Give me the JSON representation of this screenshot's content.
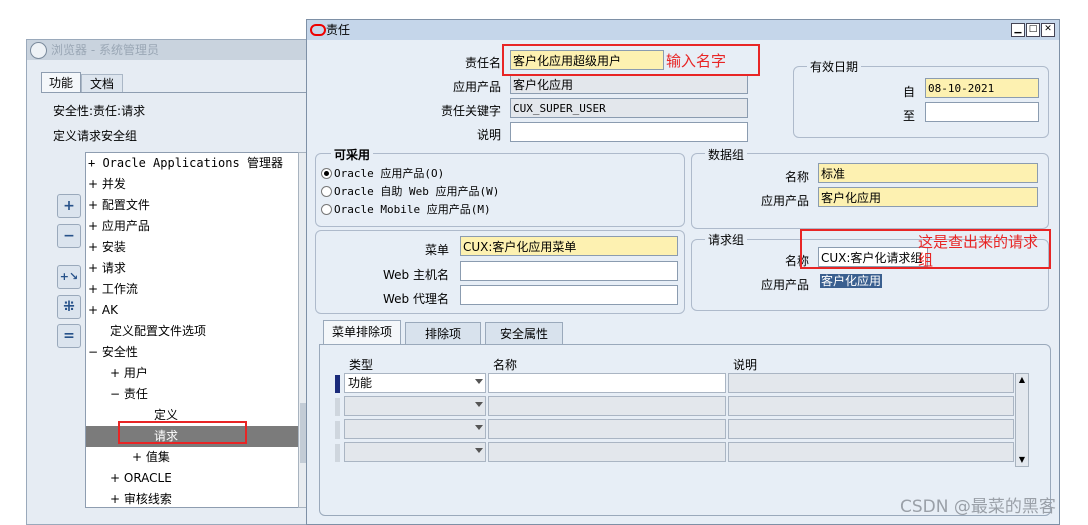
{
  "navigator": {
    "title": "浏览器 - 系统管理员",
    "tabs": [
      "功能",
      "文档"
    ],
    "header1": "安全性:责任:请求",
    "header2": "定义请求安全组",
    "tree": [
      {
        "text": "+  Oracle Applications 管理器",
        "indent": 0,
        "mono": true
      },
      {
        "text": "+  并发",
        "indent": 0
      },
      {
        "text": "+  配置文件",
        "indent": 0
      },
      {
        "text": "+  应用产品",
        "indent": 0
      },
      {
        "text": "+  安装",
        "indent": 0
      },
      {
        "text": "+  请求",
        "indent": 0
      },
      {
        "text": "+  工作流",
        "indent": 0
      },
      {
        "text": "+  AK",
        "indent": 0
      },
      {
        "text": "定义配置文件选项",
        "indent": 1
      },
      {
        "text": "−  安全性",
        "indent": 0
      },
      {
        "text": "+  用户",
        "indent": 1
      },
      {
        "text": "−  责任",
        "indent": 1
      },
      {
        "text": "定义",
        "indent": 3
      },
      {
        "text": "请求",
        "indent": 3,
        "selected": true
      },
      {
        "text": "+  值集",
        "indent": 2
      },
      {
        "text": "+  ORACLE",
        "indent": 1
      },
      {
        "text": "+  审核线索",
        "indent": 1
      }
    ],
    "side_buttons": [
      "expand-icon",
      "collapse-icon",
      "expand-branch-icon",
      "expand-all-icon",
      "collapse-all-icon"
    ]
  },
  "form": {
    "title": "责任",
    "resp_name_label": "责任名",
    "resp_name": "客户化应用超级用户",
    "app_label": "应用产品",
    "app_value": "客户化应用",
    "key_label": "责任关键字",
    "key_value": "CUX_SUPER_USER",
    "desc_label": "说明",
    "desc_value": "",
    "effective": {
      "group": "有效日期",
      "from_label": "自",
      "from_value": "08-10-2021",
      "to_label": "至",
      "to_value": ""
    },
    "available": {
      "group": "可采用",
      "options": [
        "Oracle 应用产品(O)",
        "Oracle 自助 Web 应用产品(W)",
        "Oracle Mobile 应用产品(M)"
      ],
      "selected_index": 0
    },
    "data_group": {
      "group": "数据组",
      "name_label": "名称",
      "name_value": "标准",
      "app_label": "应用产品",
      "app_value": "客户化应用"
    },
    "menu_label": "菜单",
    "menu_value": "CUX:客户化应用菜单",
    "web_host_label": "Web 主机名",
    "web_host_value": "",
    "web_agent_label": "Web 代理名",
    "web_agent_value": "",
    "request_group": {
      "group": "请求组",
      "name_label": "名称",
      "name_value": "CUX:客户化请求组",
      "app_label": "应用产品",
      "app_value": "客户化应用"
    },
    "tabs": [
      "菜单排除项",
      "排除项",
      "安全属性"
    ],
    "grid": {
      "columns": [
        "类型",
        "名称",
        "说明"
      ],
      "rows": [
        {
          "type": "功能",
          "name": "",
          "desc": ""
        },
        {
          "type": "",
          "name": "",
          "desc": ""
        },
        {
          "type": "",
          "name": "",
          "desc": ""
        },
        {
          "type": "",
          "name": "",
          "desc": ""
        }
      ]
    }
  },
  "annotations": {
    "name_note": "输入名字",
    "group_note": "这是查出来的请求组"
  },
  "watermark": "CSDN @最菜的黑客",
  "colors": {
    "required": "#fdf1b1",
    "highlight_red": "#e82525",
    "selection": "#7b7b7b"
  }
}
